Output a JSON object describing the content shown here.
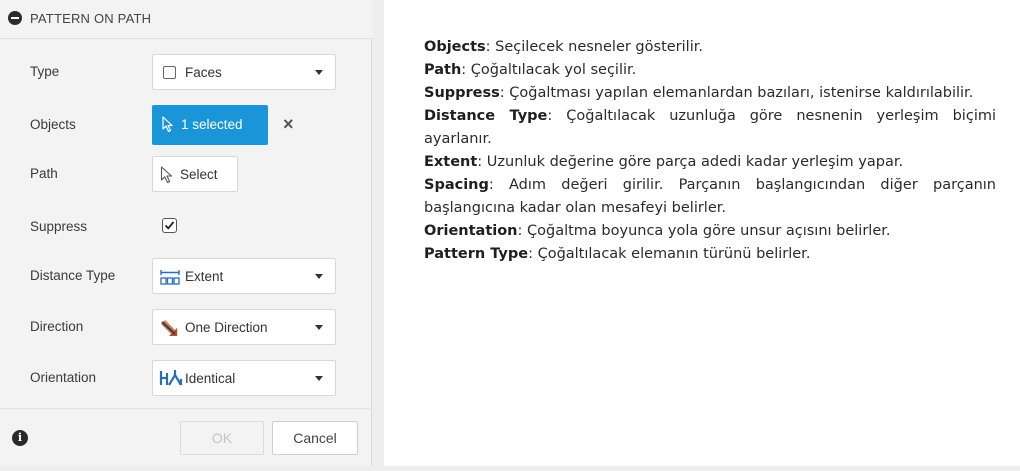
{
  "dialog": {
    "title": "PATTERN ON PATH",
    "rows": {
      "type": {
        "label": "Type",
        "value": "Faces"
      },
      "objects": {
        "label": "Objects",
        "value": "1 selected"
      },
      "path": {
        "label": "Path",
        "value": "Select"
      },
      "suppress": {
        "label": "Suppress",
        "checked": true
      },
      "distance_type": {
        "label": "Distance Type",
        "value": "Extent"
      },
      "direction": {
        "label": "Direction",
        "value": "One Direction"
      },
      "orientation": {
        "label": "Orientation",
        "value": "Identical"
      }
    },
    "ok_label": "OK",
    "cancel_label": "Cancel",
    "accent_color": "#1a96d8"
  },
  "descriptions": [
    {
      "term": "Objects",
      "text": ": Seçilecek nesneler gösterilir."
    },
    {
      "term": "Path",
      "text": ": Çoğaltılacak yol seçilir."
    },
    {
      "term": "Suppress",
      "text": ": Çoğaltması yapılan elemanlardan bazıları, istenirse kaldırılabilir."
    },
    {
      "term": "Distance Type",
      "text": ": Çoğaltılacak uzunluğa göre nesnenin yerleşim biçimi ayarlanır."
    },
    {
      "term": "Extent",
      "text": ": Uzunluk değerine göre parça adedi kadar yerleşim yapar."
    },
    {
      "term": "Spacing",
      "text": ": Adım değeri girilir. Parçanın başlangıcından diğer parçanın başlangıcına kadar olan mesafeyi belirler."
    },
    {
      "term": "Orientation",
      "text": ": Çoğaltma boyunca yola göre unsur açısını belirler."
    },
    {
      "term": "Pattern Type",
      "text": ": Çoğaltılacak elemanın türünü belirler."
    }
  ]
}
